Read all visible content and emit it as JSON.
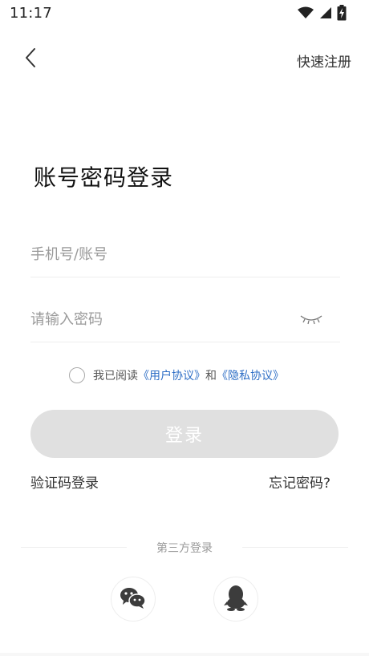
{
  "status_bar": {
    "time": "11:17",
    "icons": [
      "wifi-icon",
      "signal-icon",
      "battery-icon"
    ]
  },
  "header": {
    "back_icon": "chevron-left-icon",
    "quick_register_label": "快速注册"
  },
  "title": "账号密码登录",
  "form": {
    "account_placeholder": "手机号/账号",
    "account_value": "",
    "password_placeholder": "请输入密码",
    "password_value": "",
    "eye_icon": "eye-closed-icon"
  },
  "agreement": {
    "checked": false,
    "prefix": "我已阅读",
    "user_agreement": "《用户协议》",
    "conjunction": "和",
    "privacy_policy": "《隐私协议》"
  },
  "actions": {
    "login_label": "登录",
    "sms_login_label": "验证码登录",
    "forgot_password_label": "忘记密码?"
  },
  "third_party": {
    "label": "第三方登录",
    "providers": [
      {
        "icon": "wechat-icon"
      },
      {
        "icon": "qq-icon"
      }
    ]
  },
  "colors": {
    "link": "#2f6fc6",
    "login_button_disabled": "#e0e0e0",
    "placeholder": "#9a9a9a"
  }
}
